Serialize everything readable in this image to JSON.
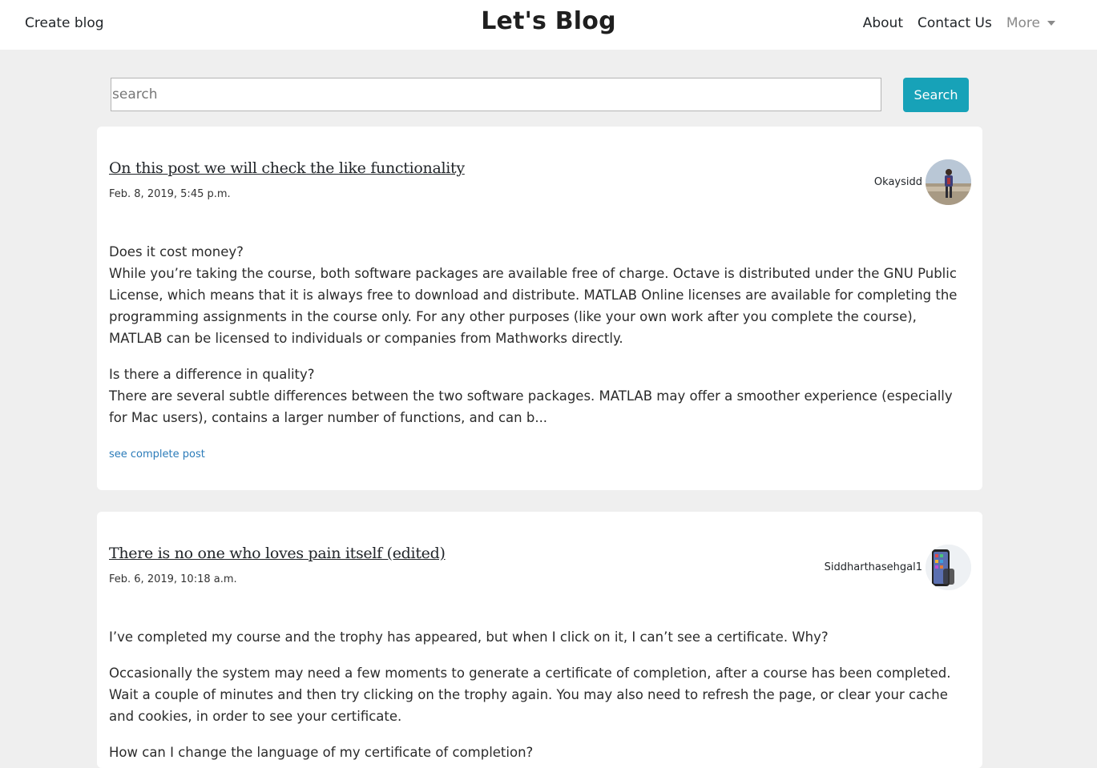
{
  "navbar": {
    "create_blog": "Create blog",
    "brand": "Let's Blog",
    "about": "About",
    "contact": "Contact Us",
    "more": "More"
  },
  "search": {
    "placeholder": "search",
    "button": "Search"
  },
  "colors": {
    "accent": "#17a2b8",
    "link": "#2b7bb9",
    "page_bg": "#efefef"
  },
  "posts": [
    {
      "title": "On this post we will check the like functionality",
      "date": "Feb. 8, 2019, 5:45 p.m.",
      "author": "Okaysidd",
      "paragraphs": [
        "Does it cost money?",
        "While you’re taking the course, both software packages are available free of charge. Octave is distributed under the GNU Public License, which means that it is always free to download and distribute. MATLAB Online licenses are available for completing the programming assignments in the course only. For any other purposes (like your own work after you complete the course), MATLAB can be licensed to individuals or companies from Mathworks directly.",
        "Is there a difference in quality?",
        "There are several subtle differences between the two software packages. MATLAB may offer a smoother experience (especially for Mac users), contains a larger number of functions, and can b..."
      ],
      "see_more": "see complete post"
    },
    {
      "title": "There is no one who loves pain itself (edited)",
      "date": "Feb. 6, 2019, 10:18 a.m.",
      "author": "Siddharthasehgal1",
      "paragraphs": [
        "I’ve completed my course and the trophy has appeared, but when I click on it, I can’t see a certificate. Why?",
        "Occasionally the system may need a few moments to generate a certificate of completion, after a course has been completed. Wait a couple of minutes and then try clicking on the trophy again. You may also need to refresh the page, or clear your cache and cookies, in order to see your certificate.",
        "How can I change the language of my certificate of completion?"
      ]
    }
  ]
}
